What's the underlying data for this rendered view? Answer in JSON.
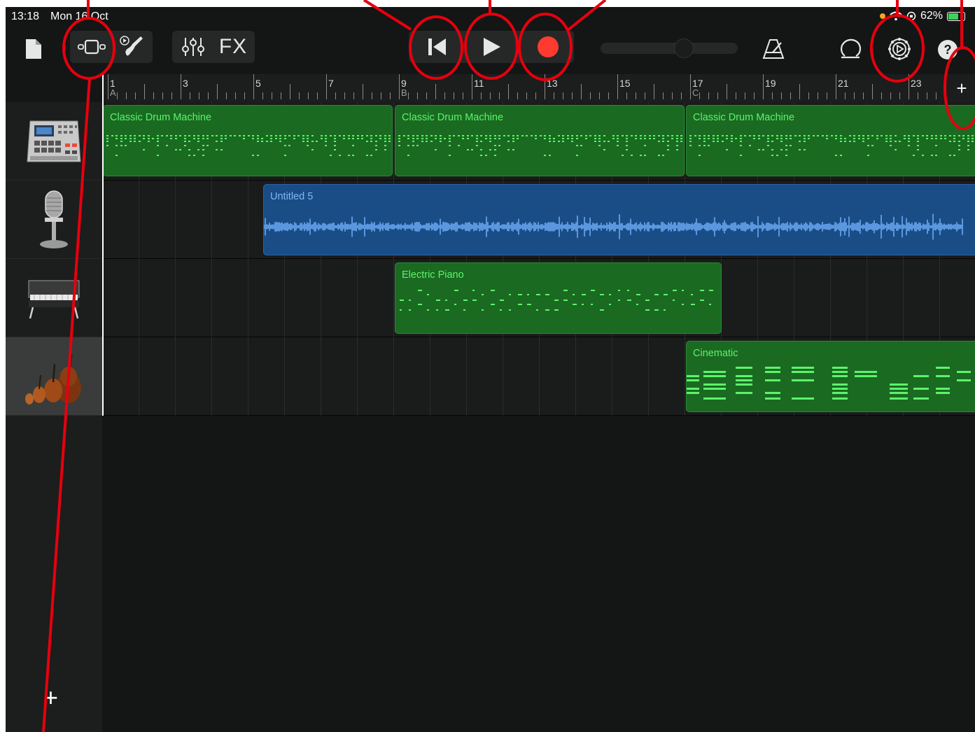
{
  "status_bar": {
    "time": "13:18",
    "date": "Mon 16 Oct",
    "battery": "62%",
    "battery_level": 0.62
  },
  "toolbar": {
    "fx_label": "FX"
  },
  "ruler": {
    "bars": [
      {
        "num": "1",
        "section": "A"
      },
      {
        "num": "3",
        "section": ""
      },
      {
        "num": "5",
        "section": ""
      },
      {
        "num": "7",
        "section": ""
      },
      {
        "num": "9",
        "section": "B"
      },
      {
        "num": "11",
        "section": ""
      },
      {
        "num": "13",
        "section": ""
      },
      {
        "num": "15",
        "section": ""
      },
      {
        "num": "17",
        "section": "C"
      },
      {
        "num": "19",
        "section": ""
      },
      {
        "num": "21",
        "section": ""
      },
      {
        "num": "23",
        "section": ""
      }
    ],
    "add_section_label": "+"
  },
  "tracks": [
    {
      "name": "drum-machine",
      "icon": "drum-machine-icon"
    },
    {
      "name": "microphone",
      "icon": "microphone-icon"
    },
    {
      "name": "electric-piano",
      "icon": "electric-piano-icon"
    },
    {
      "name": "strings",
      "icon": "strings-icon",
      "selected": true
    }
  ],
  "add_track_label": "+",
  "regions": {
    "drum_1": "Classic Drum Machine",
    "drum_2": "Classic Drum Machine",
    "drum_3": "Classic Drum Machine",
    "audio": "Untitled 5",
    "piano": "Electric Piano",
    "cinematic": "Cinematic"
  },
  "colors": {
    "midi_region": "#1a6a22",
    "midi_note": "#5df36b",
    "audio_region": "#1a4d86",
    "record": "#ff3b30",
    "annotation": "#e6000e"
  }
}
